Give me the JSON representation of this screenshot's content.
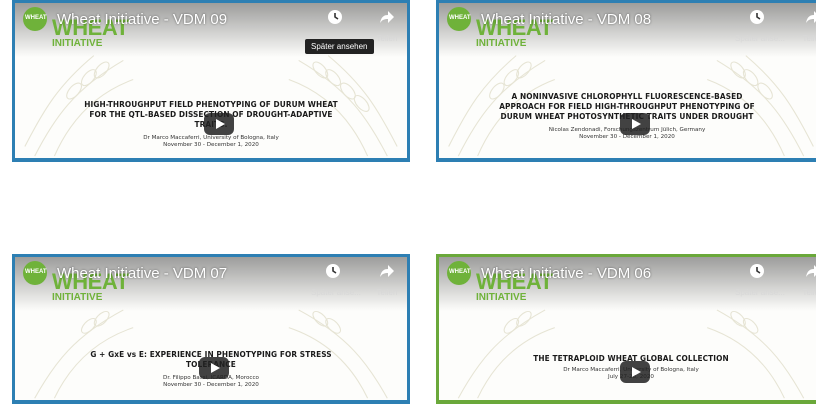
{
  "videos": [
    {
      "title": "Wheat Initiative - VDM 09",
      "logo_word1": "WHEAT",
      "logo_word2": "INITIATIVE",
      "badge": "WHEAT",
      "slide_title": "HIGH-THROUGHPUT FIELD PHENOTYPING OF DURUM WHEAT FOR THE QTL-BASED DISSECTION OF DROUGHT-ADAPTIVE TRAITS.",
      "author": "Dr Marco Maccaferri, University of Bologna, Italy",
      "date": "November 30 - December 1, 2020",
      "watch_later": "",
      "share": "Teilen",
      "tooltip": "Später ansehen"
    },
    {
      "title": "Wheat Initiative - VDM 08",
      "logo_word1": "WHEAT",
      "logo_word2": "INITIATIVE",
      "badge": "WHEAT",
      "slide_title": "A NONINVASIVE CHLOROPHYLL FLUORESCENCE-BASED APPROACH FOR FIELD HIGH-THROUGHPUT PHENOTYPING OF DURUM WHEAT PHOTOSYNTHETIC TRAITS UNDER DROUGHT",
      "author": "Nicolas Zendonadi, Forschungszentrum Jülich, Germany",
      "date": "November 30 - December 1, 2020",
      "watch_later": "Später anse...",
      "share": "Teilen"
    },
    {
      "title": "Wheat Initiative - VDM 07",
      "logo_word1": "WHEAT",
      "logo_word2": "INITIATIVE",
      "badge": "WHEAT",
      "slide_title": "G + GxE vs E: EXPERIENCE IN PHENOTYPING FOR STRESS TOLERANCE",
      "author": "Dr. Filippo Bassi, ICARDA, Morocco",
      "date": "November 30 - December 1, 2020",
      "watch_later": "Später anse...",
      "share": "Teilen"
    },
    {
      "title": "Wheat Initiative - VDM 06",
      "logo_word1": "WHEAT",
      "logo_word2": "INITIATIVE",
      "badge": "WHEAT",
      "slide_title": "THE TETRAPLOID WHEAT GLOBAL COLLECTION",
      "author": "Dr Marco Maccaferri, University of Bologna, Italy",
      "date": "July 27-28, 2020",
      "watch_later": "Später anse...",
      "share": "Teilen"
    }
  ]
}
